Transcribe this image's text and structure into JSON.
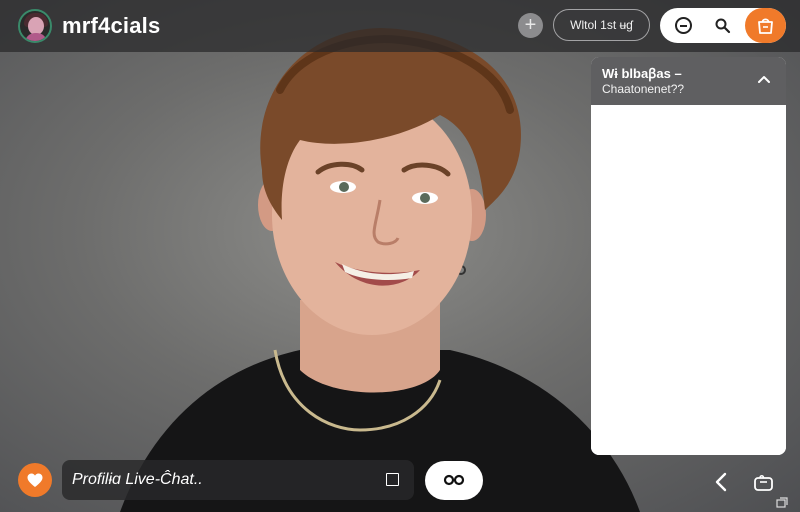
{
  "header": {
    "brand": "mrf4cials",
    "status_pill": "Wltol 1st   ʉɠ"
  },
  "chat": {
    "title": "Wɨ blbaꞵas –",
    "subtitle": "Chaatonenet??"
  },
  "footer": {
    "chat_input_label": "Profilɨɑ Live-Ĉhat.."
  },
  "icons": {
    "avatar": "avatar-icon",
    "add": "plus-icon",
    "minus": "minus-circle-icon",
    "search": "search-icon",
    "bag": "shopping-bag-icon",
    "collapse": "chevron-up-icon",
    "heart": "heart-icon",
    "square": "square-icon",
    "go": "infinity-icon",
    "back": "chevron-left-icon",
    "gift": "gift-box-icon",
    "corner": "resize-icon"
  },
  "colors": {
    "accent": "#f07a2a",
    "topbar": "#3a3a3c",
    "panel_header": "#5f5f61"
  }
}
